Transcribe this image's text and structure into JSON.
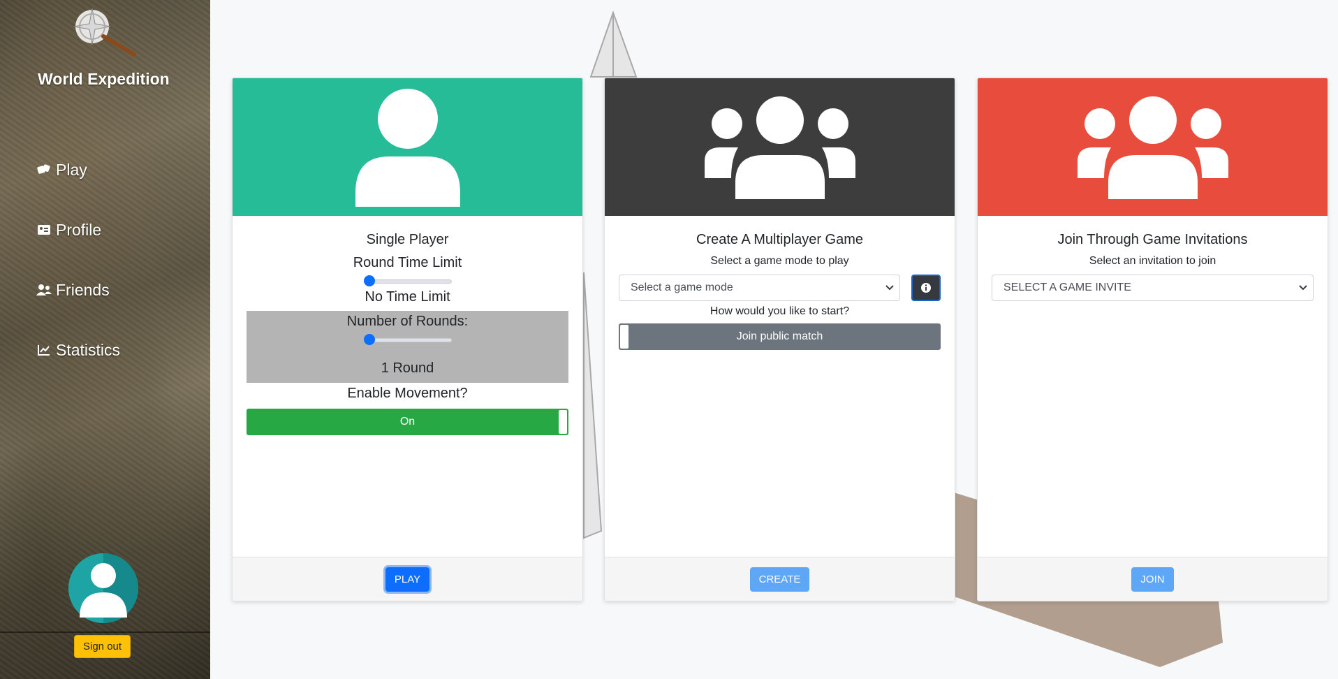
{
  "app": {
    "brand": "World Expedition"
  },
  "sidebar": {
    "items": [
      {
        "label": "Play",
        "icon": "dice-icon"
      },
      {
        "label": "Profile",
        "icon": "id-card-icon"
      },
      {
        "label": "Friends",
        "icon": "users-icon"
      },
      {
        "label": "Statistics",
        "icon": "chart-line-icon"
      }
    ],
    "sign_out": "Sign out"
  },
  "cards": {
    "single": {
      "header_color": "#26bc98",
      "title": "Single Player",
      "time_label": "Round Time Limit",
      "time_value_text": "No Time Limit",
      "time_slider_value": 0,
      "rounds_label": "Number of Rounds:",
      "rounds_value_text": "1 Round",
      "rounds_slider_value": 0,
      "movement_label": "Enable Movement?",
      "movement_toggle": "On",
      "button": "PLAY"
    },
    "multi": {
      "header_color": "#3d3d3d",
      "title": "Create A Multiplayer Game",
      "mode_prompt": "Select a game mode to play",
      "mode_select": "Select a game mode",
      "start_prompt": "How would you like to start?",
      "start_toggle": "Join public match",
      "button": "CREATE"
    },
    "join": {
      "header_color": "#e74c3c",
      "title": "Join Through Game Invitations",
      "invite_prompt": "Select an invitation to join",
      "invite_select": "SELECT A GAME INVITE",
      "button": "JOIN"
    }
  }
}
